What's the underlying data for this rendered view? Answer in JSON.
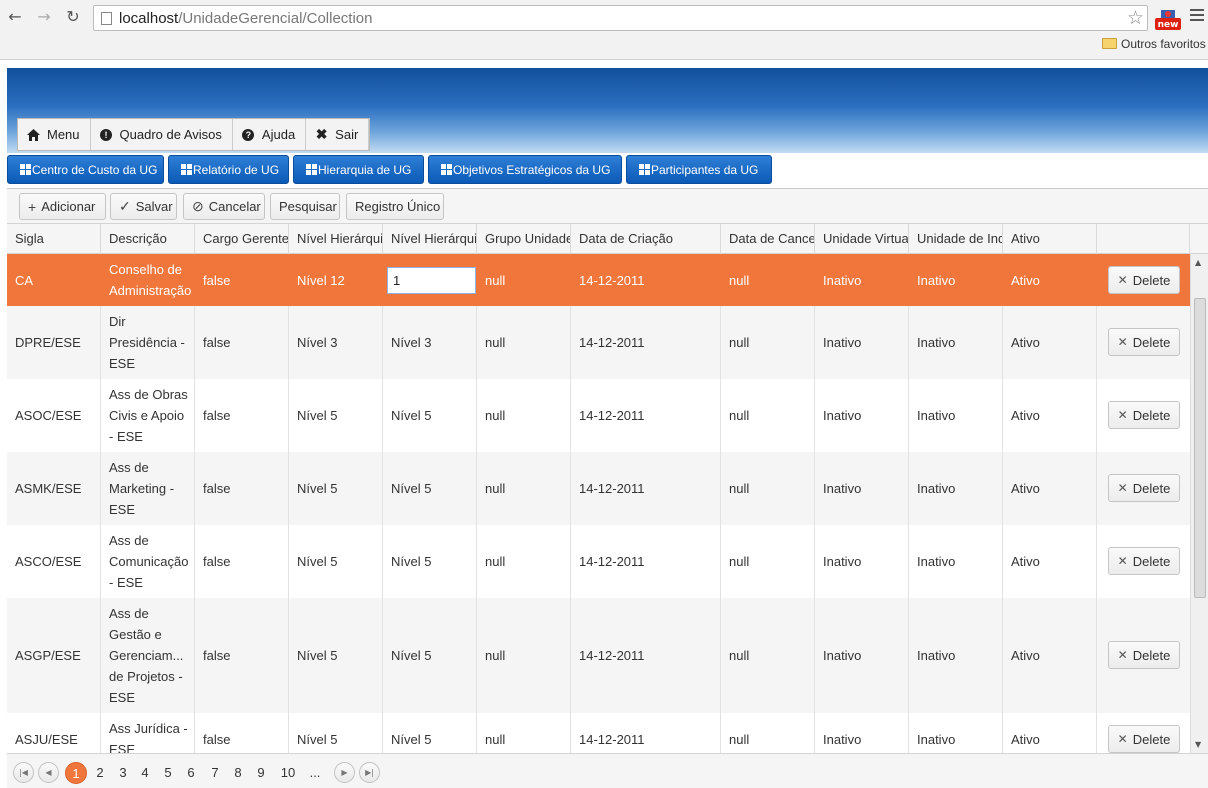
{
  "browser": {
    "url_host": "localhost",
    "url_path": "/UnidadeGerencial/Collection",
    "bookmarks_label": "Outros favoritos"
  },
  "topmenu": [
    {
      "label": "Menu",
      "icon": "home-icon"
    },
    {
      "label": "Quadro de Avisos",
      "icon": "exclamation-circle-icon"
    },
    {
      "label": "Ajuda",
      "icon": "question-circle-icon"
    },
    {
      "label": "Sair",
      "icon": "close-x-icon"
    }
  ],
  "tabs": [
    "Centro de Custo da UG",
    "Relatório de UG",
    "Hierarquia de UG",
    "Objetivos Estratégicos da UG",
    "Participantes da UG"
  ],
  "toolbar": {
    "add": "Adicionar",
    "save": "Salvar",
    "cancel": "Cancelar",
    "search": "Pesquisar",
    "single": "Registro Único"
  },
  "columns": [
    "Sigla",
    "Descrição",
    "Cargo Gerente",
    "Nível Hierárquico",
    "Nível Hierárquico",
    "Grupo Unidade",
    "Data de Criação",
    "Data de Cancelamento",
    "Unidade Virtual",
    "Unidade de Indicador",
    "Ativo"
  ],
  "delete_label": "Delete",
  "edit_value": "1",
  "rows": [
    {
      "sigla": "CA",
      "descricao": "Conselho de Administração",
      "cargo": "false",
      "nivel1": "Nível 12",
      "nivel2": "1",
      "grupo": "null",
      "criacao": "14-12-2011",
      "cancel": "null",
      "virtual": "Inativo",
      "indicador": "Inativo",
      "ativo": "Ativo"
    },
    {
      "sigla": "DPRE/ESE",
      "descricao": "Dir Presidência - ESE",
      "cargo": "false",
      "nivel1": "Nível 3",
      "nivel2": "Nível 3",
      "grupo": "null",
      "criacao": "14-12-2011",
      "cancel": "null",
      "virtual": "Inativo",
      "indicador": "Inativo",
      "ativo": "Ativo"
    },
    {
      "sigla": "ASOC/ESE",
      "descricao": "Ass de Obras Civis e Apoio - ESE",
      "cargo": "false",
      "nivel1": "Nível 5",
      "nivel2": "Nível 5",
      "grupo": "null",
      "criacao": "14-12-2011",
      "cancel": "null",
      "virtual": "Inativo",
      "indicador": "Inativo",
      "ativo": "Ativo"
    },
    {
      "sigla": "ASMK/ESE",
      "descricao": "Ass de Marketing - ESE",
      "cargo": "false",
      "nivel1": "Nível 5",
      "nivel2": "Nível 5",
      "grupo": "null",
      "criacao": "14-12-2011",
      "cancel": "null",
      "virtual": "Inativo",
      "indicador": "Inativo",
      "ativo": "Ativo"
    },
    {
      "sigla": "ASCO/ESE",
      "descricao": "Ass de Comunicação - ESE",
      "cargo": "false",
      "nivel1": "Nível 5",
      "nivel2": "Nível 5",
      "grupo": "null",
      "criacao": "14-12-2011",
      "cancel": "null",
      "virtual": "Inativo",
      "indicador": "Inativo",
      "ativo": "Ativo"
    },
    {
      "sigla": "ASGP/ESE",
      "descricao": "Ass de Gestão e Gerenciam... de Projetos - ESE",
      "cargo": "false",
      "nivel1": "Nível 5",
      "nivel2": "Nível 5",
      "grupo": "null",
      "criacao": "14-12-2011",
      "cancel": "null",
      "virtual": "Inativo",
      "indicador": "Inativo",
      "ativo": "Ativo"
    },
    {
      "sigla": "ASJU/ESE",
      "descricao": "Ass Jurídica - ESE",
      "cargo": "false",
      "nivel1": "Nível 5",
      "nivel2": "Nível 5",
      "grupo": "null",
      "criacao": "14-12-2011",
      "cancel": "null",
      "virtual": "Inativo",
      "indicador": "Inativo",
      "ativo": "Ativo"
    }
  ],
  "pager": {
    "pages": [
      "1",
      "2",
      "3",
      "4",
      "5",
      "6",
      "7",
      "8",
      "9",
      "10",
      "..."
    ],
    "current": "1"
  },
  "colors": {
    "selected_row": "#f1763b",
    "tab_blue": "#0b5ab7"
  }
}
